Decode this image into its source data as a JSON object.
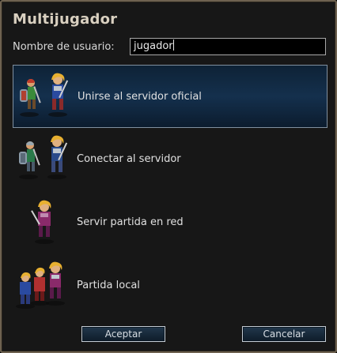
{
  "dialog": {
    "title": "Multijugador"
  },
  "username": {
    "label": "Nombre de usuario:",
    "value": "jugador"
  },
  "options": [
    {
      "label": "Unirse al servidor oficial",
      "icon": "two-warriors-icon",
      "selected": true
    },
    {
      "label": "Conectar al servidor",
      "icon": "two-warriors-icon",
      "selected": false
    },
    {
      "label": "Servir partida en red",
      "icon": "single-warrior-icon",
      "selected": false
    },
    {
      "label": "Partida local",
      "icon": "warrior-group-icon",
      "selected": false
    }
  ],
  "buttons": {
    "ok": "Aceptar",
    "cancel": "Cancelar"
  },
  "colors": {
    "background": "#171717",
    "border": "#6e6250",
    "title": "#d9d0c0",
    "selection": "#14304d"
  }
}
